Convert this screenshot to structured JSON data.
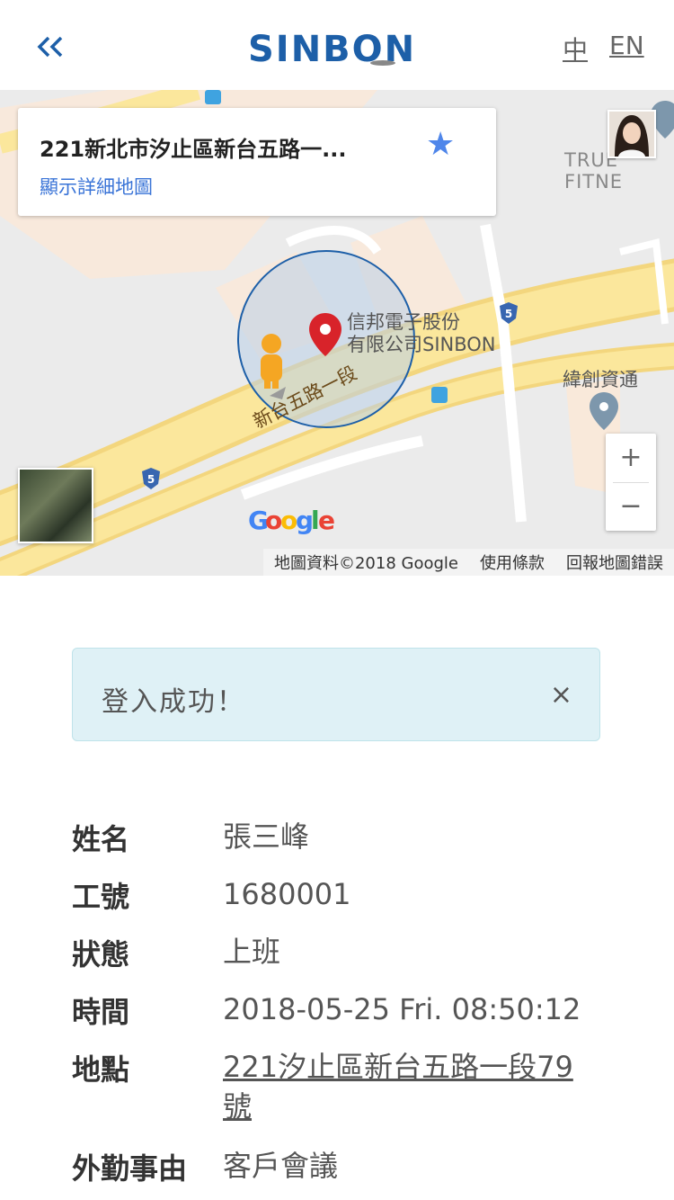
{
  "header": {
    "back_icon": "double-chevron-left-icon",
    "logo_text": "SINBON",
    "brand_color": "#1d5fa8",
    "lang_zh": "中",
    "lang_en": "EN"
  },
  "map": {
    "place_address": "221新北市汐止區新台五路一...",
    "detail_link": "顯示詳細地圖",
    "marker_label_line1": "信邦電子股份",
    "marker_label_line2": "有限公司SINBON",
    "poi_label": "緯創資通",
    "poi_label_2": "TRUE FITNE",
    "road_label": "新台五路一段",
    "route_shield": "5",
    "google_logo": "Google",
    "footer_data": "地圖資料©2018 Google",
    "footer_terms": "使用條款",
    "footer_report": "回報地圖錯誤",
    "zoom_in": "+",
    "zoom_out": "−"
  },
  "alert": {
    "message": "登入成功！",
    "close": "×",
    "color": "#dff1f6"
  },
  "info": [
    {
      "label": "姓名",
      "value": "張三峰"
    },
    {
      "label": "工號",
      "value": "1680001"
    },
    {
      "label": "狀態",
      "value": "上班"
    },
    {
      "label": "時間",
      "value": "2018-05-25 Fri. 08:50:12"
    },
    {
      "label": "地點",
      "value": "221汐止區新台五路一段79號"
    },
    {
      "label": "外勤事由",
      "value": "客戶會議"
    }
  ]
}
